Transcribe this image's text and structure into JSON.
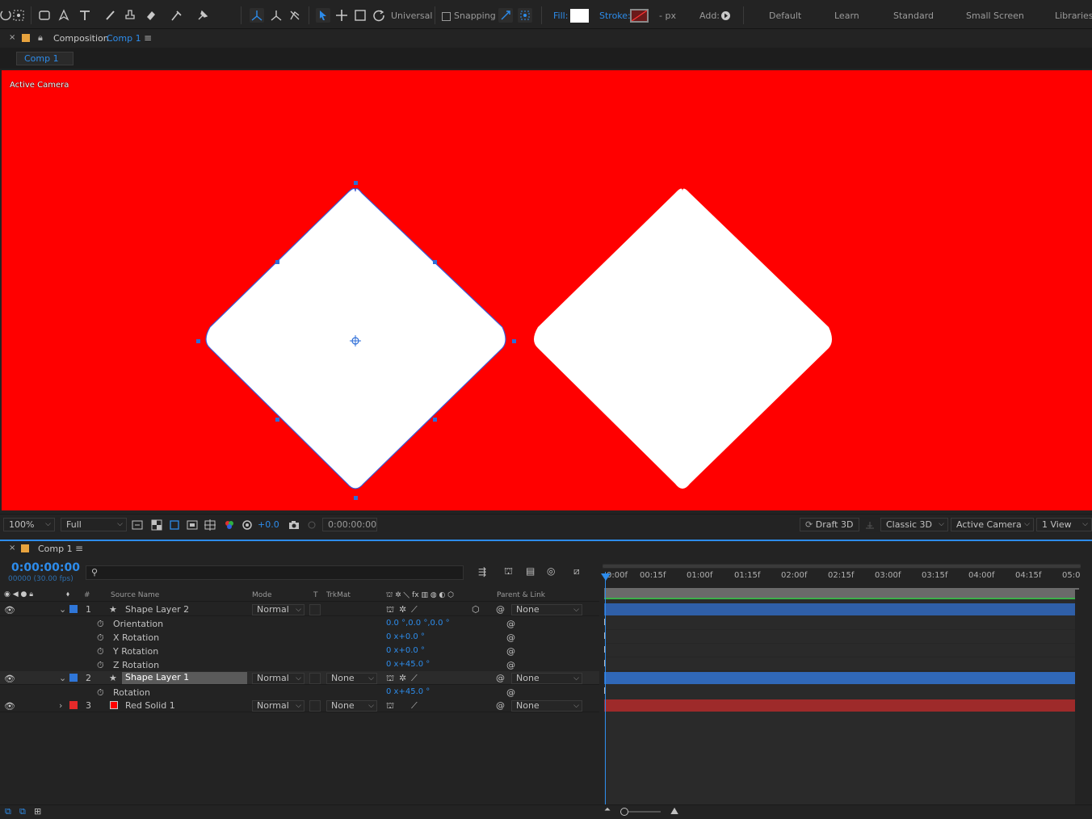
{
  "toolbar": {
    "universal_label": "Universal",
    "snapping_label": "Snapping",
    "fill_label": "Fill:",
    "stroke_label": "Stroke:",
    "stroke_unit": "- px",
    "add_label": "Add:",
    "workspaces": [
      "Default",
      "Learn",
      "Standard",
      "Small Screen",
      "Libraries"
    ],
    "accent_color": "#2d8ceb"
  },
  "comp_panel": {
    "title_prefix": "Composition",
    "title_comp": "Comp 1",
    "flow_tab": "Comp 1",
    "viewer_label": "Active Camera",
    "background_color": "#ff0000"
  },
  "viewer_bar": {
    "zoom": "100%",
    "resolution": "Full",
    "exposure": "+0.0",
    "timecode": "0:00:00:00",
    "renderer_label": "Draft 3D",
    "renderer": "Classic 3D",
    "view": "Active Camera",
    "layout": "1 View"
  },
  "timeline": {
    "tab_label": "Comp 1",
    "current_time": "0:00:00:00",
    "frames_fps": "00000 (30.00 fps)",
    "columns": {
      "number": "#",
      "source_name": "Source Name",
      "mode": "Mode",
      "t": "T",
      "trkmat": "TrkMat",
      "parent": "Parent & Link"
    },
    "ruler": [
      "0:00f",
      "00:15f",
      "01:00f",
      "01:15f",
      "02:00f",
      "02:15f",
      "03:00f",
      "03:15f",
      "04:00f",
      "04:15f",
      "05:0"
    ],
    "layers": [
      {
        "num": "1",
        "name": "Shape Layer 2",
        "mode": "Normal",
        "trkmat": "",
        "parent": "None",
        "color": "#2f76d8",
        "props": [
          {
            "name": "Orientation",
            "value": "0.0 °,0.0 °,0.0 °"
          },
          {
            "name": "X Rotation",
            "value": "0 x+0.0 °"
          },
          {
            "name": "Y Rotation",
            "value": "0 x+0.0 °"
          },
          {
            "name": "Z Rotation",
            "value": "0 x+45.0 °"
          }
        ]
      },
      {
        "num": "2",
        "name": "Shape Layer 1",
        "mode": "Normal",
        "trkmat": "None",
        "parent": "None",
        "color": "#2f76d8",
        "props": [
          {
            "name": "Rotation",
            "value": "0 x+45.0 °"
          }
        ]
      },
      {
        "num": "3",
        "name": "Red Solid 1",
        "mode": "Normal",
        "trkmat": "None",
        "parent": "None",
        "color": "#e52a2a",
        "props": []
      }
    ]
  }
}
